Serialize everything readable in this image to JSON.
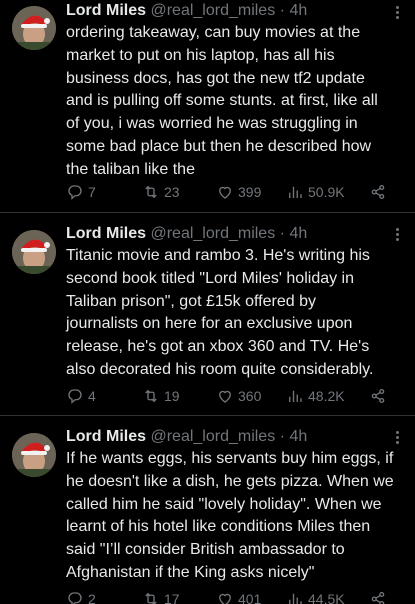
{
  "tweets": [
    {
      "author": {
        "name": "Lord Miles",
        "handle": "@real_lord_miles",
        "time": "4h"
      },
      "text": "ordering takeaway, can buy movies at the\nmarket to put on his laptop, has all his\nbusiness docs, has got the new tf2 update\nand is pulling off some stunts. at first, like all\nof you, i was worried he was struggling in\nsome bad place but then he described how\nthe taliban like the",
      "stats": {
        "replies": "7",
        "retweets": "23",
        "likes": "399",
        "views": "50.9K"
      }
    },
    {
      "author": {
        "name": "Lord Miles",
        "handle": "@real_lord_miles",
        "time": "4h"
      },
      "text": "Titanic movie and rambo 3. He's writing his\nsecond book titled \"Lord Miles' holiday in\nTaliban prison\", got £15k offered by\njournalists on here for an exclusive upon\nrelease, he's got an xbox 360 and TV. He's\nalso decorated his room quite considerably.",
      "stats": {
        "replies": "4",
        "retweets": "19",
        "likes": "360",
        "views": "48.2K"
      }
    },
    {
      "author": {
        "name": "Lord Miles",
        "handle": "@real_lord_miles",
        "time": "4h"
      },
      "text": "If he wants eggs, his servants buy him eggs, if\nhe doesn't like a dish, he gets pizza. When we\ncalled him he said \"lovely holiday\". When we\nlearnt of his hotel like conditions Miles then\nsaid \"I’ll consider British ambassador to\nAfghanistan if the King asks nicely\"",
      "stats": {
        "replies": "2",
        "retweets": "17",
        "likes": "401",
        "views": "44.5K"
      }
    }
  ],
  "separator": "·",
  "icons": [
    "reply-icon",
    "retweet-icon",
    "like-icon",
    "views-icon",
    "share-icon",
    "more-icon"
  ]
}
